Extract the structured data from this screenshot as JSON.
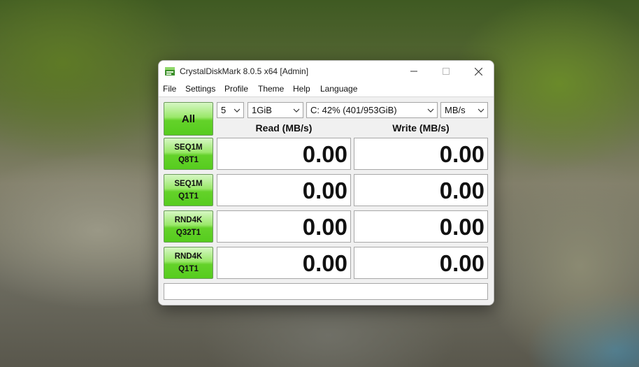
{
  "window": {
    "title": "CrystalDiskMark 8.0.5 x64 [Admin]"
  },
  "menu": [
    "File",
    "Settings",
    "Profile",
    "Theme",
    "Help",
    "Language"
  ],
  "controls": {
    "all_label": "All",
    "count": "5",
    "size": "1GiB",
    "drive": "C: 42% (401/953GiB)",
    "unit": "MB/s"
  },
  "headers": {
    "read": "Read (MB/s)",
    "write": "Write (MB/s)"
  },
  "tests": [
    {
      "line1": "SEQ1M",
      "line2": "Q8T1",
      "read": "0.00",
      "write": "0.00"
    },
    {
      "line1": "SEQ1M",
      "line2": "Q1T1",
      "read": "0.00",
      "write": "0.00"
    },
    {
      "line1": "RND4K",
      "line2": "Q32T1",
      "read": "0.00",
      "write": "0.00"
    },
    {
      "line1": "RND4K",
      "line2": "Q1T1",
      "read": "0.00",
      "write": "0.00"
    }
  ],
  "status": "",
  "colors": {
    "button_green": "#64d22a",
    "background": "#f0f0f0"
  },
  "icons": [
    "app-icon",
    "minimize-icon",
    "maximize-icon",
    "close-icon",
    "chevron-down-icon"
  ]
}
